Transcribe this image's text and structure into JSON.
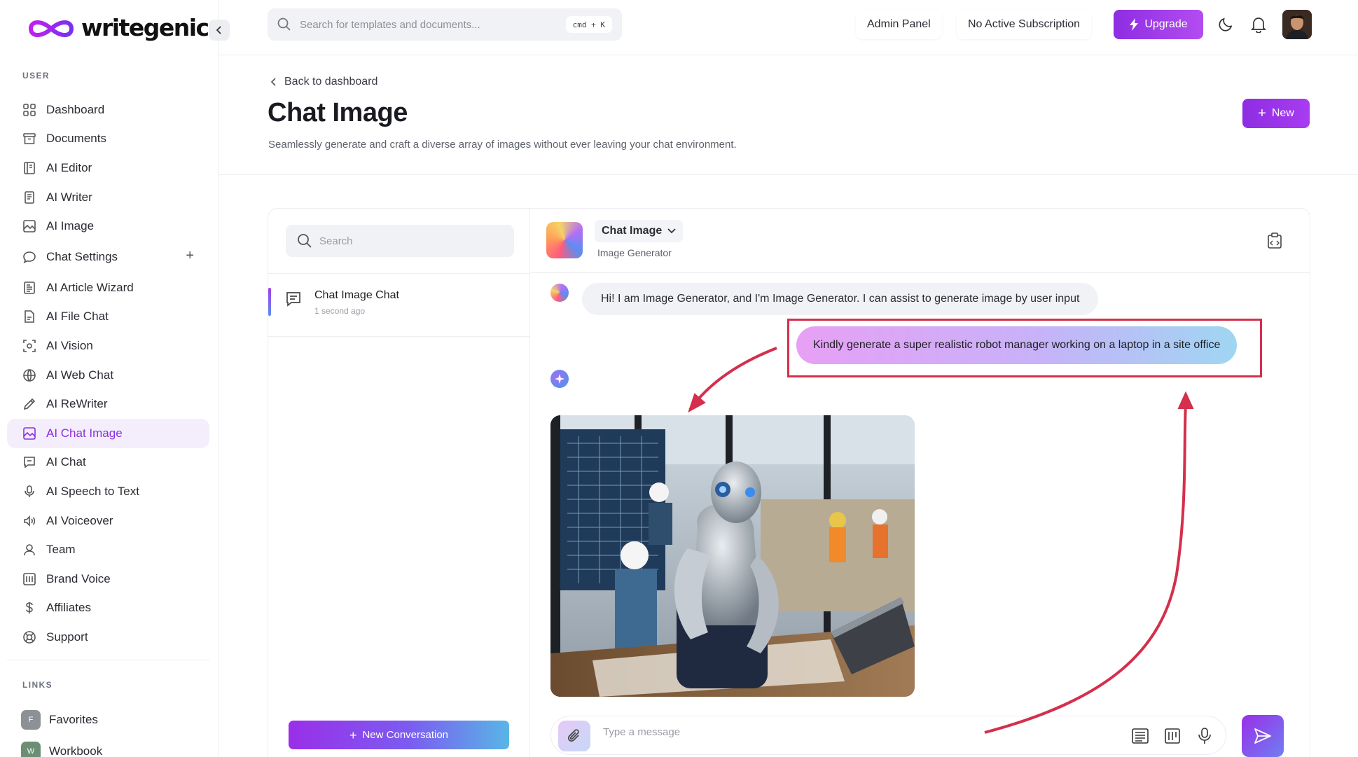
{
  "app": {
    "logo_text": "writegenic"
  },
  "sidebar": {
    "user_section_label": "USER",
    "links_section_label": "LINKS",
    "items": [
      {
        "label": "Dashboard",
        "icon": "grid-icon"
      },
      {
        "label": "Documents",
        "icon": "archive-icon"
      },
      {
        "label": "AI Editor",
        "icon": "book-icon"
      },
      {
        "label": "AI Writer",
        "icon": "document-icon"
      },
      {
        "label": "AI Image",
        "icon": "image-icon"
      },
      {
        "label": "Chat Settings",
        "icon": "chat-bubble-icon"
      },
      {
        "label": "AI Article Wizard",
        "icon": "article-icon"
      },
      {
        "label": "AI File Chat",
        "icon": "file-chat-icon"
      },
      {
        "label": "AI Vision",
        "icon": "vision-icon"
      },
      {
        "label": "AI Web Chat",
        "icon": "web-icon"
      },
      {
        "label": "AI ReWriter",
        "icon": "pen-icon"
      },
      {
        "label": "AI Chat Image",
        "icon": "image-icon",
        "active": true
      },
      {
        "label": "AI Chat",
        "icon": "chat-icon"
      },
      {
        "label": "AI Speech to Text",
        "icon": "microphone-icon"
      },
      {
        "label": "AI Voiceover",
        "icon": "speaker-icon"
      },
      {
        "label": "Team",
        "icon": "user-icon"
      },
      {
        "label": "Brand Voice",
        "icon": "brand-icon"
      },
      {
        "label": "Affiliates",
        "icon": "dollar-icon"
      },
      {
        "label": "Support",
        "icon": "lifebuoy-icon"
      }
    ],
    "links": [
      {
        "badge": "F",
        "label": "Favorites"
      },
      {
        "badge": "W",
        "label": "Workbook"
      }
    ]
  },
  "topbar": {
    "search_placeholder": "Search for templates and documents...",
    "shortcut": "cmd + K",
    "admin_panel": "Admin Panel",
    "subscription": "No Active Subscription",
    "upgrade": "Upgrade"
  },
  "page": {
    "back_link": "Back to dashboard",
    "title": "Chat Image",
    "description": "Seamlessly generate and craft a diverse array of images without ever leaving your chat environment.",
    "new_button": "New"
  },
  "conversations": {
    "search_placeholder": "Search",
    "items": [
      {
        "title": "Chat Image Chat",
        "time": "1 second ago"
      }
    ],
    "new_button": "New Conversation"
  },
  "chat": {
    "bot_name": "Chat Image",
    "bot_subtitle": "Image Generator",
    "messages": [
      {
        "role": "bot",
        "text": "Hi! I am Image Generator, and I'm Image Generator. I can assist to generate image by user input"
      },
      {
        "role": "user",
        "text": "Kindly generate a super realistic robot manager working on a laptop in a site office"
      },
      {
        "role": "bot",
        "type": "image",
        "description": "robot manager working on a laptop in a site office"
      }
    ],
    "composer_placeholder": "Type a message"
  },
  "colors": {
    "accent": "#8e2de2",
    "active_bg": "#f4eefc",
    "annotation": "#d42f4c"
  }
}
